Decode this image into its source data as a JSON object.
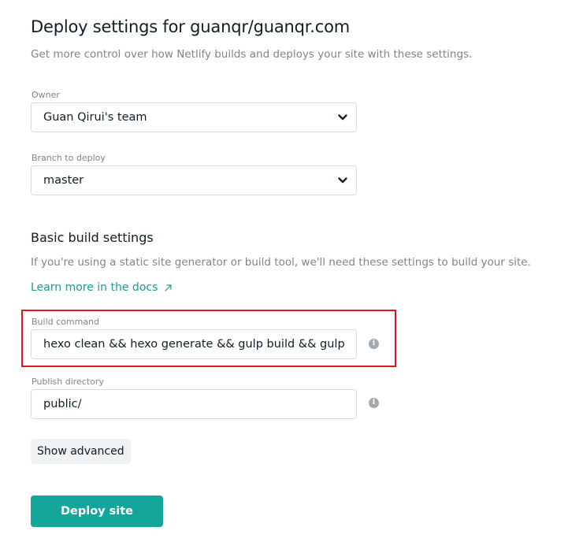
{
  "header": {
    "title": "Deploy settings for guanqr/guanqr.com",
    "subtitle": "Get more control over how Netlify builds and deploys your site with these settings."
  },
  "owner": {
    "label": "Owner",
    "value": "Guan Qirui's team"
  },
  "branch": {
    "label": "Branch to deploy",
    "value": "master"
  },
  "basic_build": {
    "title": "Basic build settings",
    "description": "If you're using a static site generator or build tool, we'll need these settings to build your site.",
    "docs_link": "Learn more in the docs"
  },
  "build_command": {
    "label": "Build command",
    "value": "hexo clean && hexo generate && gulp build && gulp"
  },
  "publish_directory": {
    "label": "Publish directory",
    "value": "public/"
  },
  "buttons": {
    "show_advanced": "Show advanced",
    "deploy_site": "Deploy site"
  },
  "icons": {
    "select_arrow": "chevron-down-icon",
    "external_link": "arrow-up-right-icon",
    "info": "info-icon"
  },
  "colors": {
    "accent": "#14a69a",
    "link": "#1d9b8f",
    "highlight": "#e0141e",
    "muted_text": "#7d8589"
  }
}
